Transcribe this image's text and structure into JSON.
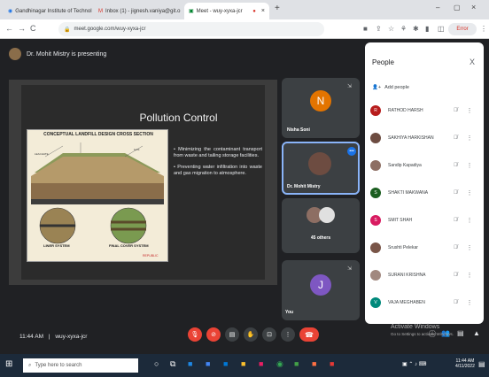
{
  "browser": {
    "tabs": [
      {
        "title": "Gandhinagar Institute of Technol"
      },
      {
        "title": "Inbox (1) - jignesh.vaniya@git.o"
      },
      {
        "title": "Meet - wuy-xyxa-jcr"
      }
    ],
    "new_tab": "+",
    "url": "meet.google.com/wuy-xyxa-jcr",
    "profile_label": "Error"
  },
  "meet": {
    "presenter_text": "Dr. Mohit Mistry is presenting",
    "time": "11:44 AM",
    "separator": "|",
    "meeting_code": "wuy-xyxa-jcr"
  },
  "slide": {
    "title": "Pollution Control",
    "diagram_title": "CONCEPTUAL LANDFILL DESIGN CROSS SECTION",
    "liner_label": "LINER SYSTEM",
    "cover_label": "FINAL COVER SYSTEM",
    "logo_text": "REPUBLIC",
    "bullets": [
      "Minimizing the contaminant transport from waste and tailing storage facilities.",
      "Preventing water infiltration into waste and gas migration to atmosphere."
    ]
  },
  "tiles": [
    {
      "name": "Nisha Soni",
      "initial": "N",
      "color": "#e37400"
    },
    {
      "name": "Dr. Mohit Mistry",
      "initial": "",
      "color": "#5f6368"
    },
    {
      "name": "45 others",
      "initial": "",
      "color": "#5f6368"
    },
    {
      "name": "You",
      "initial": "J",
      "color": "#7e57c2"
    }
  ],
  "people_panel": {
    "title": "People",
    "close": "X",
    "add_people": "Add people",
    "people": [
      {
        "name": "RATHOD HARSH",
        "initial": "R",
        "color": "#b71c1c"
      },
      {
        "name": "SAKHIYA HARKISHAN",
        "initial": "",
        "color": "#6d4c41"
      },
      {
        "name": "Sandip Kapadiya",
        "initial": "",
        "color": "#8d6e63"
      },
      {
        "name": "SHAKTI MAKWANA",
        "initial": "S",
        "color": "#1b5e20"
      },
      {
        "name": "SMIT SHAH",
        "initial": "S",
        "color": "#d81b60"
      },
      {
        "name": "Srushti Pelekar",
        "initial": "",
        "color": "#795548"
      },
      {
        "name": "SURANI KRISHNA",
        "initial": "",
        "color": "#a1887f"
      },
      {
        "name": "VAJA MEGHABEN",
        "initial": "V",
        "color": "#00897b"
      }
    ]
  },
  "watermark": {
    "line1": "Activate Windows",
    "line2": "Go to Settings to activate Windows."
  },
  "taskbar": {
    "search_placeholder": "Type here to search",
    "clock_time": "11:44 AM",
    "clock_date": "4/11/2022"
  }
}
